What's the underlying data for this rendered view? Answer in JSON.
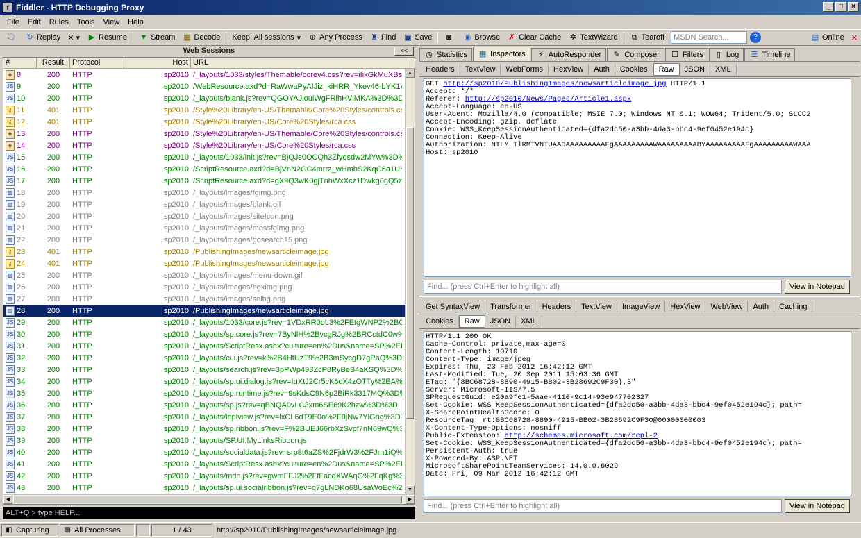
{
  "window": {
    "title": "Fiddler - HTTP Debugging Proxy"
  },
  "menu": [
    "File",
    "Edit",
    "Rules",
    "Tools",
    "View",
    "Help"
  ],
  "toolbar": {
    "replay": "Replay",
    "remove": "✕",
    "resume": "Resume",
    "stream": "Stream",
    "decode": "Decode",
    "keep": "Keep: All sessions",
    "any_process": "Any Process",
    "find": "Find",
    "save": "Save",
    "browse": "Browse",
    "clear_cache": "Clear Cache",
    "textwizard": "TextWizard",
    "tearoff": "Tearoff",
    "search_placeholder": "MSDN Search...",
    "online": "Online"
  },
  "sessions": {
    "header": "Web Sessions",
    "collapse": "<<",
    "columns": {
      "num": "#",
      "result": "Result",
      "protocol": "Protocol",
      "host": "Host",
      "url": "URL"
    },
    "rows": [
      {
        "num": "8",
        "result": "200",
        "protocol": "HTTP",
        "host": "sp2010",
        "url": "/_layouts/1033/styles/Themable/corev4.css?rev=iIikGkMuXBs8",
        "color": "purple",
        "icon": "lock"
      },
      {
        "num": "9",
        "result": "200",
        "protocol": "HTTP",
        "host": "sp2010",
        "url": "/WebResource.axd?d=RaWwaPyAIJiz_kiHRR_Ykev46-bYK1W5",
        "color": "green",
        "icon": "js"
      },
      {
        "num": "10",
        "result": "200",
        "protocol": "HTTP",
        "host": "sp2010",
        "url": "/_layouts/blank.js?rev=QGOYAJlouiWgFRlhHVlMKA%3D%3D",
        "color": "green",
        "icon": "js"
      },
      {
        "num": "11",
        "result": "401",
        "protocol": "HTTP",
        "host": "sp2010",
        "url": "/Style%20Library/en-US/Themable/Core%20Styles/controls.cs",
        "color": "gold",
        "icon": "key"
      },
      {
        "num": "12",
        "result": "401",
        "protocol": "HTTP",
        "host": "sp2010",
        "url": "/Style%20Library/en-US/Core%20Styles/rca.css",
        "color": "gold",
        "icon": "key"
      },
      {
        "num": "13",
        "result": "200",
        "protocol": "HTTP",
        "host": "sp2010",
        "url": "/Style%20Library/en-US/Themable/Core%20Styles/controls.cs",
        "color": "purple",
        "icon": "lock"
      },
      {
        "num": "14",
        "result": "200",
        "protocol": "HTTP",
        "host": "sp2010",
        "url": "/Style%20Library/en-US/Core%20Styles/rca.css",
        "color": "purple",
        "icon": "lock"
      },
      {
        "num": "15",
        "result": "200",
        "protocol": "HTTP",
        "host": "sp2010",
        "url": "/_layouts/1033/init.js?rev=BjQJs0OCQh3Zfydsdw2MYw%3D%",
        "color": "green",
        "icon": "js"
      },
      {
        "num": "16",
        "result": "200",
        "protocol": "HTTP",
        "host": "sp2010",
        "url": "/ScriptResource.axd?d=BjVnN2GC4mrrz_wHmbS2KqC6a1UHeD",
        "color": "green",
        "icon": "js"
      },
      {
        "num": "17",
        "result": "200",
        "protocol": "HTTP",
        "host": "sp2010",
        "url": "/ScriptResource.axd?d=gX9Q3wK0gjTnhWxXcz1Dwkg6gQ5zYv",
        "color": "green",
        "icon": "js"
      },
      {
        "num": "18",
        "result": "200",
        "protocol": "HTTP",
        "host": "sp2010",
        "url": "/_layouts/images/fgimg.png",
        "color": "gray",
        "icon": "img"
      },
      {
        "num": "19",
        "result": "200",
        "protocol": "HTTP",
        "host": "sp2010",
        "url": "/_layouts/images/blank.gif",
        "color": "gray",
        "icon": "img"
      },
      {
        "num": "20",
        "result": "200",
        "protocol": "HTTP",
        "host": "sp2010",
        "url": "/_layouts/images/siteIcon.png",
        "color": "gray",
        "icon": "img"
      },
      {
        "num": "21",
        "result": "200",
        "protocol": "HTTP",
        "host": "sp2010",
        "url": "/_layouts/images/mossfgimg.png",
        "color": "gray",
        "icon": "img"
      },
      {
        "num": "22",
        "result": "200",
        "protocol": "HTTP",
        "host": "sp2010",
        "url": "/_layouts/images/gosearch15.png",
        "color": "gray",
        "icon": "img"
      },
      {
        "num": "23",
        "result": "401",
        "protocol": "HTTP",
        "host": "sp2010",
        "url": "/PublishingImages/newsarticleimage.jpg",
        "color": "gold",
        "icon": "key"
      },
      {
        "num": "24",
        "result": "401",
        "protocol": "HTTP",
        "host": "sp2010",
        "url": "/PublishingImages/newsarticleimage.jpg",
        "color": "gold",
        "icon": "key"
      },
      {
        "num": "25",
        "result": "200",
        "protocol": "HTTP",
        "host": "sp2010",
        "url": "/_layouts/images/menu-down.gif",
        "color": "gray",
        "icon": "img"
      },
      {
        "num": "26",
        "result": "200",
        "protocol": "HTTP",
        "host": "sp2010",
        "url": "/_layouts/images/bgximg.png",
        "color": "gray",
        "icon": "img"
      },
      {
        "num": "27",
        "result": "200",
        "protocol": "HTTP",
        "host": "sp2010",
        "url": "/_layouts/images/selbg.png",
        "color": "gray",
        "icon": "img"
      },
      {
        "num": "28",
        "result": "200",
        "protocol": "HTTP",
        "host": "sp2010",
        "url": "/PublishingImages/newsarticleimage.jpg",
        "color": "selected",
        "icon": "img"
      },
      {
        "num": "29",
        "result": "200",
        "protocol": "HTTP",
        "host": "sp2010",
        "url": "/_layouts/1033/core.js?rev=1VDxRR0oL3%2FEtgWNP2%2BGl",
        "color": "green",
        "icon": "js"
      },
      {
        "num": "30",
        "result": "200",
        "protocol": "HTTP",
        "host": "sp2010",
        "url": "/_layouts/sp.core.js?rev=7ByNlH%2BvcgRJg%2BRCctdC0w%",
        "color": "green",
        "icon": "js"
      },
      {
        "num": "31",
        "result": "200",
        "protocol": "HTTP",
        "host": "sp2010",
        "url": "/_layouts/ScriptResx.ashx?culture=en%2Dus&name=SP%2ER",
        "color": "green",
        "icon": "js"
      },
      {
        "num": "32",
        "result": "200",
        "protocol": "HTTP",
        "host": "sp2010",
        "url": "/_layouts/cui.js?rev=k%2B4HtUzT9%2B3mSycgD7gPaQ%3D%",
        "color": "green",
        "icon": "js"
      },
      {
        "num": "33",
        "result": "200",
        "protocol": "HTTP",
        "host": "sp2010",
        "url": "/_layouts/search.js?rev=3pPWp493ZcP8RyBeS4aKSQ%3D%3",
        "color": "green",
        "icon": "js"
      },
      {
        "num": "34",
        "result": "200",
        "protocol": "HTTP",
        "host": "sp2010",
        "url": "/_layouts/sp.ui.dialog.js?rev=IuXtJ2Cr5cK6oX4zOTTy%2BA%",
        "color": "green",
        "icon": "js"
      },
      {
        "num": "35",
        "result": "200",
        "protocol": "HTTP",
        "host": "sp2010",
        "url": "/_layouts/sp.runtime.js?rev=9sKdsC9N6p2BiRk3317MQ%3D%",
        "color": "green",
        "icon": "js"
      },
      {
        "num": "36",
        "result": "200",
        "protocol": "HTTP",
        "host": "sp2010",
        "url": "/_layouts/sp.js?rev=qBNQA0vLC3xm6SE69K2hzw%3D%3D",
        "color": "green",
        "icon": "js"
      },
      {
        "num": "37",
        "result": "200",
        "protocol": "HTTP",
        "host": "sp2010",
        "url": "/_layouts/inplview.js?rev=lxCL6dT9E0o%2F9jNw7YlGng%3D%",
        "color": "green",
        "icon": "js"
      },
      {
        "num": "38",
        "result": "200",
        "protocol": "HTTP",
        "host": "sp2010",
        "url": "/_layouts/sp.ribbon.js?rev=F%2BUEJ66rbXzSvpf7nN69wQ%3",
        "color": "green",
        "icon": "js"
      },
      {
        "num": "39",
        "result": "200",
        "protocol": "HTTP",
        "host": "sp2010",
        "url": "/_layouts/SP.UI.MyLinksRibbon.js",
        "color": "green",
        "icon": "js"
      },
      {
        "num": "40",
        "result": "200",
        "protocol": "HTTP",
        "host": "sp2010",
        "url": "/_layouts/socialdata.js?rev=srp8t6aZS%2FjdrW3%2FJrn1iQ%",
        "color": "green",
        "icon": "js"
      },
      {
        "num": "41",
        "result": "200",
        "protocol": "HTTP",
        "host": "sp2010",
        "url": "/_layouts/ScriptResx.ashx?culture=en%2Dus&name=SP%2EU",
        "color": "green",
        "icon": "js"
      },
      {
        "num": "42",
        "result": "200",
        "protocol": "HTTP",
        "host": "sp2010",
        "url": "/_layouts/mdn.js?rev=gwmFFJ2%2FfFacqXWAqG%2FqKg%3D%",
        "color": "green",
        "icon": "js"
      },
      {
        "num": "43",
        "result": "200",
        "protocol": "HTTP",
        "host": "sp2010",
        "url": "/_layouts/sp.ui.socialribbon.js?rev=q7gLNDKo68UsaWoEc%2F",
        "color": "green",
        "icon": "js"
      }
    ]
  },
  "quickexec": "ALT+Q > type HELP...",
  "inspector_tabs": [
    "Statistics",
    "Inspectors",
    "AutoResponder",
    "Composer",
    "Filters",
    "Log",
    "Timeline"
  ],
  "request": {
    "tabs": [
      "Headers",
      "TextView",
      "WebForms",
      "HexView",
      "Auth",
      "Cookies",
      "Raw",
      "JSON",
      "XML"
    ],
    "lines": [
      {
        "pre": "GET ",
        "link": "http://sp2010/PublishingImages/newsarticleimage.jpg",
        "post": " HTTP/1.1"
      },
      {
        "pre": "Accept: */*",
        "link": "",
        "post": ""
      },
      {
        "pre": "Referer: ",
        "link": "http://sp2010/News/Pages/Article1.aspx",
        "post": ""
      },
      {
        "pre": "Accept-Language: en-US",
        "link": "",
        "post": ""
      },
      {
        "pre": "User-Agent: Mozilla/4.0 (compatible; MSIE 7.0; Windows NT 6.1; WOW64; Trident/5.0; SLCC2",
        "link": "",
        "post": ""
      },
      {
        "pre": "Accept-Encoding: gzip, deflate",
        "link": "",
        "post": ""
      },
      {
        "pre": "Cookie: WSS_KeepSessionAuthenticated={dfa2dc50-a3bb-4da3-bbc4-9ef0452e194c}",
        "link": "",
        "post": ""
      },
      {
        "pre": "Connection: Keep-Alive",
        "link": "",
        "post": ""
      },
      {
        "pre": "Authorization: NTLM TlRMTVNTUAADAAAAAAAAAFgAAAAAAAAAWAAAAAAAAABYAAAAAAAAAFgAAAAAAAAAWAAA",
        "link": "",
        "post": ""
      },
      {
        "pre": "Host: sp2010",
        "link": "",
        "post": ""
      }
    ],
    "find_placeholder": "Find... (press Ctrl+Enter to highlight all)",
    "notepad": "View in Notepad"
  },
  "response": {
    "tabs1": [
      "Get SyntaxView",
      "Transformer",
      "Headers",
      "TextView",
      "ImageView",
      "HexView",
      "WebView",
      "Auth",
      "Caching"
    ],
    "tabs2": [
      "Cookies",
      "Raw",
      "JSON",
      "XML"
    ],
    "lines": [
      {
        "pre": "HTTP/1.1 200 OK",
        "link": "",
        "post": ""
      },
      {
        "pre": "Cache-Control: private,max-age=0",
        "link": "",
        "post": ""
      },
      {
        "pre": "Content-Length: 10710",
        "link": "",
        "post": ""
      },
      {
        "pre": "Content-Type: image/jpeg",
        "link": "",
        "post": ""
      },
      {
        "pre": "Expires: Thu, 23 Feb 2012 16:42:12 GMT",
        "link": "",
        "post": ""
      },
      {
        "pre": "Last-Modified: Tue, 20 Sep 2011 15:03:36 GMT",
        "link": "",
        "post": ""
      },
      {
        "pre": "ETag: \"{8BC68728-8890-4915-BB02-3B28692C9F30},3\"",
        "link": "",
        "post": ""
      },
      {
        "pre": "Server: Microsoft-IIS/7.5",
        "link": "",
        "post": ""
      },
      {
        "pre": "SPRequestGuid: e20a9fe1-5aae-4110-9c14-93e947702327",
        "link": "",
        "post": ""
      },
      {
        "pre": "Set-Cookie: WSS_KeepSessionAuthenticated={dfa2dc50-a3bb-4da3-bbc4-9ef0452e194c}; path=",
        "link": "",
        "post": ""
      },
      {
        "pre": "X-SharePointHealthScore: 0",
        "link": "",
        "post": ""
      },
      {
        "pre": "ResourceTag: rt:8BC68728-8890-4915-BB02-3B28692C9F30@00000000003",
        "link": "",
        "post": ""
      },
      {
        "pre": "X-Content-Type-Options: nosniff",
        "link": "",
        "post": ""
      },
      {
        "pre": "Public-Extension: ",
        "link": "http://schemas.microsoft.com/repl-2",
        "post": ""
      },
      {
        "pre": "Set-Cookie: WSS_KeepSessionAuthenticated={dfa2dc50-a3bb-4da3-bbc4-9ef0452e194c}; path=",
        "link": "",
        "post": ""
      },
      {
        "pre": "Persistent-Auth: true",
        "link": "",
        "post": ""
      },
      {
        "pre": "X-Powered-By: ASP.NET",
        "link": "",
        "post": ""
      },
      {
        "pre": "MicrosoftSharePointTeamServices: 14.0.0.6029",
        "link": "",
        "post": ""
      },
      {
        "pre": "Date: Fri, 09 Mar 2012 16:42:12 GMT",
        "link": "",
        "post": ""
      }
    ],
    "find_placeholder": "Find... (press Ctrl+Enter to highlight all)",
    "notepad": "View in Notepad"
  },
  "status": {
    "capturing": "Capturing",
    "processes": "All Processes",
    "count": "1 / 43",
    "url": "http://sp2010/PublishingImages/newsarticleimage.jpg"
  }
}
